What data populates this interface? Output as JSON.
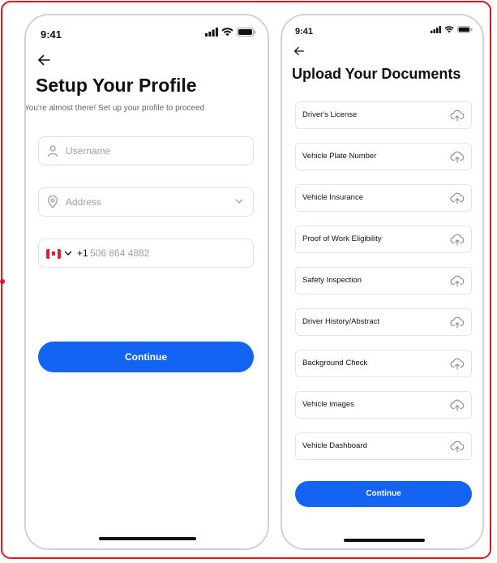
{
  "colors": {
    "accent": "#1464f4",
    "frame": "#e8141d",
    "text": "#111111",
    "muted": "#9aa2ad",
    "border": "#dde1e6"
  },
  "left_screen": {
    "time": "9:41",
    "title": "Setup Your Profile",
    "subtitle": "You're almost there!  Set up your profile to proceed",
    "username_placeholder": "Username",
    "address_placeholder": "Address",
    "country_code": "+1",
    "phone_placeholder": "506 864 4882",
    "continue_label": "Continue",
    "icons": [
      "back-arrow-icon",
      "user-icon",
      "location-pin-icon",
      "chevron-down-icon",
      "canada-flag-icon"
    ]
  },
  "right_screen": {
    "time": "9:41",
    "title": "Upload Your Documents",
    "documents": [
      "Driver's License",
      "Vehicle Plate Number",
      "Vehicle Insurance",
      "Proof of Work Eligibility",
      "Safety Inspection",
      "Driver History/Abstract",
      "Background Check",
      "Vehicle images",
      "Vehicle Dashboard"
    ],
    "continue_label": "Continue",
    "icons": [
      "back-arrow-icon",
      "cloud-upload-icon"
    ]
  }
}
